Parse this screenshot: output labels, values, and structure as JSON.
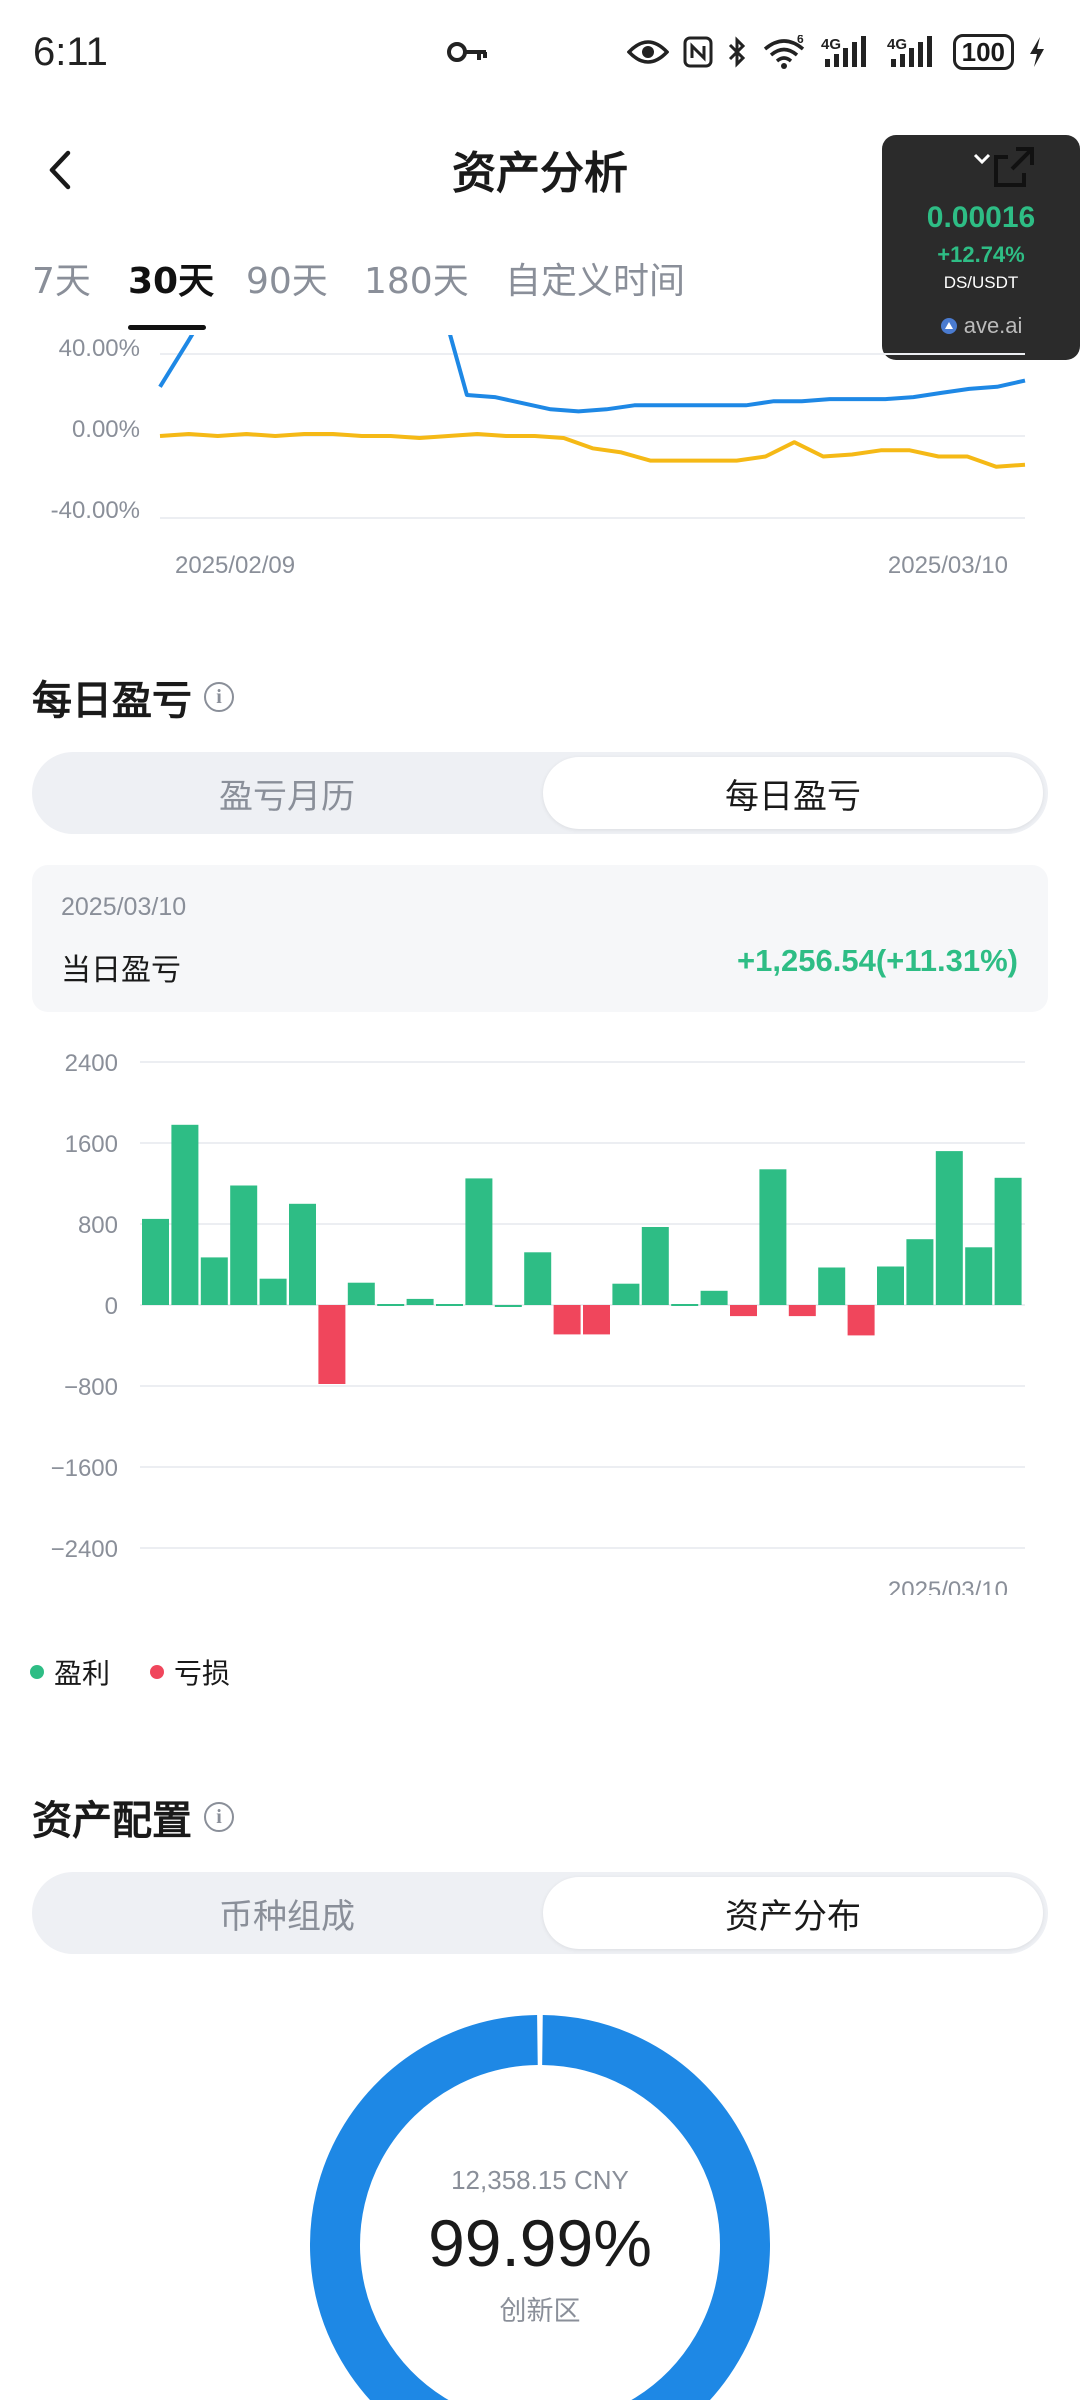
{
  "status_bar": {
    "time": "6:11",
    "battery": "100",
    "icons": [
      "key-icon",
      "eye-icon",
      "nfc-icon",
      "bluetooth-icon",
      "wifi-icon",
      "signal-4g-icon",
      "signal-4g-icon",
      "battery-icon",
      "charging-icon"
    ],
    "wifi_label": "6",
    "net1": "4G",
    "net2": "4G"
  },
  "header": {
    "title": "资产分析",
    "back_icon": "chevron-left-icon"
  },
  "time_tabs": [
    {
      "label": "7天",
      "active": false
    },
    {
      "label": "30天",
      "active": true
    },
    {
      "label": "90天",
      "active": false
    },
    {
      "label": "180天",
      "active": false
    },
    {
      "label": "自定义时间",
      "active": false
    }
  ],
  "price_widget": {
    "price": "0.00016",
    "change": "+12.74%",
    "pair": "DS/USDT",
    "brand": "ave.ai",
    "colors": {
      "up": "#2ebd85",
      "bg": "#2b2b2b"
    }
  },
  "return_chart": {
    "y_ticks": [
      "40.00%",
      "0.00%",
      "-40.00%"
    ],
    "x_ticks": [
      "2025/02/09",
      "2025/03/10"
    ]
  },
  "daily_pnl_section": {
    "title": "每日盈亏",
    "segments": [
      {
        "label": "盈亏月历",
        "active": false
      },
      {
        "label": "每日盈亏",
        "active": true
      }
    ],
    "card": {
      "date": "2025/03/10",
      "label": "当日盈亏",
      "value": "+1,256.54(+11.31%)"
    },
    "legend": [
      {
        "label": "盈利",
        "color": "#2ebd85"
      },
      {
        "label": "亏损",
        "color": "#f0465c"
      }
    ]
  },
  "chart_data": [
    {
      "type": "line",
      "ylim": [
        -40,
        40
      ],
      "y_ticks": [
        -40,
        0,
        40
      ],
      "x_tick_labels": [
        "2025/02/09",
        "2025/03/10"
      ],
      "series": [
        {
          "color": "#1e88e5",
          "values": [
            24,
            46,
            200,
            200,
            200,
            200,
            200,
            200,
            200,
            200,
            200,
            20,
            19,
            16,
            13,
            12,
            13,
            15,
            15,
            15,
            15,
            15,
            17,
            17,
            18,
            18,
            18,
            19,
            21,
            23,
            24,
            27
          ]
        },
        {
          "color": "#f5b916",
          "values": [
            0,
            1,
            0,
            1,
            0,
            1,
            1,
            0,
            0,
            -1,
            0,
            1,
            0,
            0,
            -1,
            -6,
            -8,
            -12,
            -12,
            -12,
            -12,
            -10,
            -3,
            -10,
            -9,
            -7,
            -7,
            -10,
            -10,
            -15,
            -14
          ]
        }
      ]
    },
    {
      "type": "bar",
      "title": "",
      "ylim": [
        -2400,
        2400
      ],
      "y_ticks": [
        2400,
        1600,
        800,
        0,
        -800,
        -1600,
        -2400
      ],
      "x_tick_labels": [
        "2025/03/10"
      ],
      "values": [
        850,
        1780,
        470,
        1180,
        260,
        1000,
        -780,
        220,
        10,
        60,
        10,
        1250,
        0,
        520,
        -290,
        -290,
        210,
        770,
        10,
        140,
        -110,
        1340,
        -110,
        370,
        -300,
        380,
        650,
        1520,
        570,
        1256.54
      ],
      "colors": {
        "profit": "#2ebd85",
        "loss": "#f0465c"
      }
    },
    {
      "type": "pie",
      "slices": [
        {
          "label": "创新区",
          "value": 99.99,
          "color": "#1e88e5"
        },
        {
          "label": "",
          "value": 0.01,
          "color": "#1e88e5"
        }
      ]
    }
  ],
  "asset_allocation": {
    "title": "资产配置",
    "segments": [
      {
        "label": "币种组成",
        "active": false
      },
      {
        "label": "资产分布",
        "active": true
      }
    ],
    "donut": {
      "total": "12,358.15 CNY",
      "percent": "99.99%",
      "label": "创新区"
    }
  }
}
